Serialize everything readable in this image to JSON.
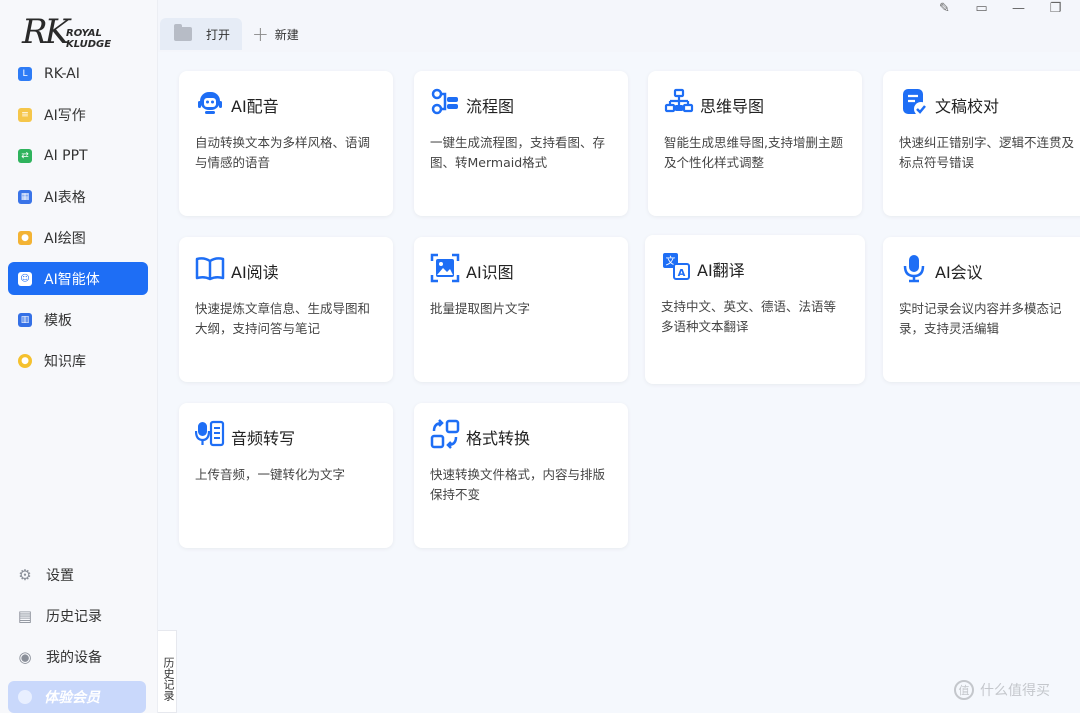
{
  "app": {
    "logo_mark": "RK",
    "logo_word1": "ROYAL",
    "logo_word2": "KLUDGE"
  },
  "sidebar": {
    "items": [
      {
        "label": "RK-AI",
        "icon": "rk-ai-icon",
        "color": "#2e7cf6"
      },
      {
        "label": "AI写作",
        "icon": "ai-writing-icon",
        "color": "#f5c64a"
      },
      {
        "label": "AI PPT",
        "icon": "ai-ppt-icon",
        "color": "#2fb35d"
      },
      {
        "label": "AI表格",
        "icon": "ai-table-icon",
        "color": "#3a74e8"
      },
      {
        "label": "AI绘图",
        "icon": "ai-draw-icon",
        "color": "#f3b334"
      },
      {
        "label": "AI智能体",
        "icon": "ai-agent-icon",
        "color": "#ffffff",
        "active": true
      },
      {
        "label": "模板",
        "icon": "template-icon",
        "color": "#3470e6"
      },
      {
        "label": "知识库",
        "icon": "knowledge-base-icon",
        "color": "#f5c12e"
      }
    ],
    "bottom": [
      {
        "label": "设置",
        "icon": "gear-icon"
      },
      {
        "label": "历史记录",
        "icon": "history-icon"
      },
      {
        "label": "我的设备",
        "icon": "device-icon"
      }
    ],
    "vip_label": "体验会员"
  },
  "topbar": {
    "open_label": "打开",
    "new_label": "新建"
  },
  "history_tab": "历史记录",
  "cards": [
    {
      "title": "AI配音",
      "desc": "自动转换文本为多样风格、语调与情感的语音",
      "icon": "robot-voice-icon"
    },
    {
      "title": "流程图",
      "desc": "一键生成流程图，支持看图、存图、转Mermaid格式",
      "icon": "flowchart-icon"
    },
    {
      "title": "思维导图",
      "desc": "智能生成思维导图,支持增删主题及个性化样式调整",
      "icon": "mindmap-icon"
    },
    {
      "title": "文稿校对",
      "desc": "快速纠正错别字、逻辑不连贯及标点符号错误",
      "icon": "proofread-icon"
    },
    {
      "title": "AI阅读",
      "desc": "快速提炼文章信息、生成导图和大纲，支持问答与笔记",
      "icon": "book-icon"
    },
    {
      "title": "AI识图",
      "desc": "批量提取图片文字",
      "icon": "image-recognition-icon"
    },
    {
      "title": "AI翻译",
      "desc": "支持中文、英文、德语、法语等多语种文本翻译",
      "icon": "translate-icon"
    },
    {
      "title": "AI会议",
      "desc": "实时记录会议内容并多模态记录，支持灵活编辑",
      "icon": "microphone-icon"
    },
    {
      "title": "音频转写",
      "desc": "上传音频，一键转化为文字",
      "icon": "audio-transcribe-icon"
    },
    {
      "title": "格式转换",
      "desc": "快速转换文件格式，内容与排版保持不变",
      "icon": "format-convert-icon"
    }
  ],
  "watermark": "什么值得买",
  "accent": "#1e6ef5"
}
